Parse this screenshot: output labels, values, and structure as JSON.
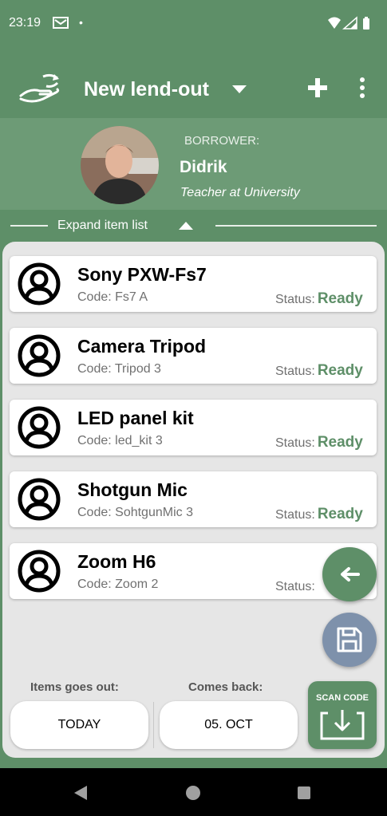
{
  "status_bar": {
    "time": "23:19",
    "dot": "•",
    "icons": [
      "mail-icon",
      "wifi-icon",
      "signal-icon",
      "battery-icon"
    ]
  },
  "app_bar": {
    "title": "New lend-out",
    "icons": [
      "lend-logo-icon",
      "dropdown-icon",
      "add-icon",
      "more-icon"
    ]
  },
  "borrower": {
    "label": "BORROWER:",
    "name": "Didrik",
    "role": "Teacher at University"
  },
  "expand": {
    "label": "Expand item list"
  },
  "items": [
    {
      "name": "Sony PXW-Fs7",
      "code": "Code: Fs7 A",
      "status_label": "Status:",
      "status": "Ready"
    },
    {
      "name": "Camera Tripod",
      "code": "Code: Tripod 3",
      "status_label": "Status:",
      "status": "Ready"
    },
    {
      "name": "LED panel kit",
      "code": "Code: led_kit 3",
      "status_label": "Status:",
      "status": "Ready"
    },
    {
      "name": "Shotgun Mic",
      "code": "Code: SohtgunMic 3",
      "status_label": "Status:",
      "status": "Ready"
    },
    {
      "name": "Zoom H6",
      "code": "Code: Zoom 2",
      "status_label": "Status:",
      "status": ""
    }
  ],
  "dates": {
    "out_label": "Items goes out:",
    "out_value": "TODAY",
    "back_label": "Comes back:",
    "back_value": "05. OCT"
  },
  "scan": {
    "label": "SCAN CODE"
  },
  "fabs": [
    "back-arrow-icon",
    "save-icon"
  ],
  "colors": {
    "primary": "#5e8f68",
    "header_light": "#6d9b76",
    "save_fab": "#7e91ab",
    "status_ready": "#5e8f68",
    "panel": "#e6e6e6"
  }
}
